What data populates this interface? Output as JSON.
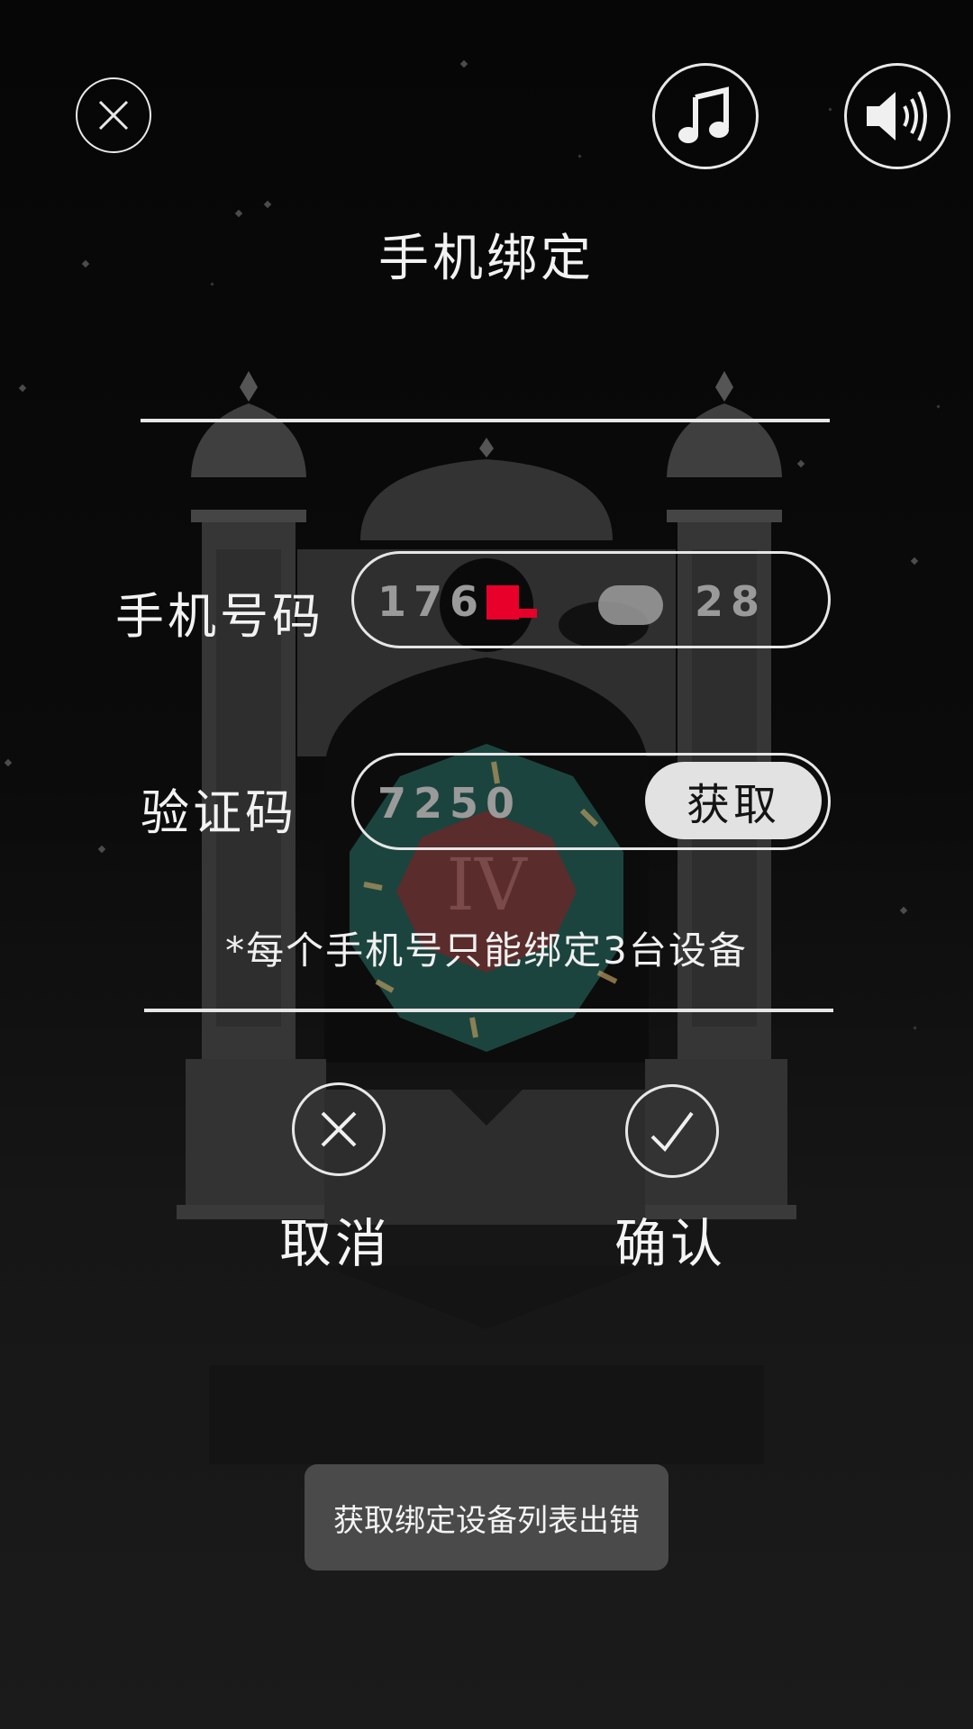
{
  "header": {
    "close_icon": "close-icon",
    "music_icon": "music-note-icon",
    "sound_icon": "speaker-icon"
  },
  "title": "手机绑定",
  "form": {
    "phone": {
      "label": "手机号码",
      "value": "176",
      "value_suffix": "28"
    },
    "code": {
      "label": "验证码",
      "value": "7250",
      "get_code_label": "获取"
    },
    "notice": "*每个手机号只能绑定3台设备"
  },
  "actions": {
    "cancel_label": "取消",
    "confirm_label": "确认"
  },
  "toast": "获取绑定设备列表出错",
  "colors": {
    "foreground": "#f2f2f2",
    "pill_border": "#e6e6e6",
    "button_bg": "#e2e2e2",
    "toast_bg": "#4a4a4a",
    "redaction": "#e8002a"
  }
}
